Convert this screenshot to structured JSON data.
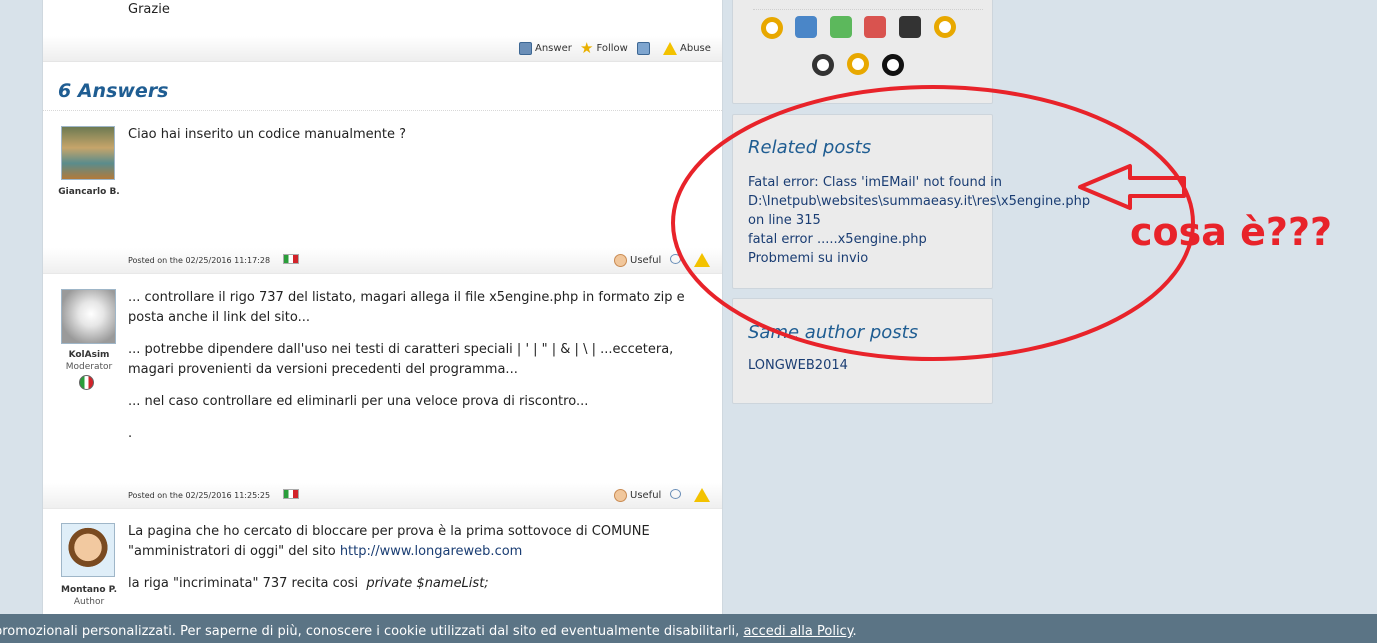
{
  "question": {
    "text": "Grazie",
    "actions": {
      "answer": "Answer",
      "follow": "Follow",
      "abuse": "Abuse"
    }
  },
  "answers_title": "6 Answers",
  "answers": [
    {
      "author": "Giancarlo B.",
      "role": "",
      "paragraphs": [
        "Ciao hai inserito un codice manualmente ?"
      ],
      "posted": "Posted on the 02/25/2016 11:17:28",
      "useful": "Useful"
    },
    {
      "author": "KolAsim",
      "role": "Moderator",
      "paragraphs": [
        "... controllare il rigo 737 del listato, magari allega il file x5engine.php in formato zip e posta anche il link del sito...",
        "... potrebbe dipendere dall'uso nei testi di caratteri speciali | ' | \" | & | \\ | ...eccetera, magari provenienti da versioni precedenti del programma...",
        "... nel caso controllare ed eliminarli per una veloce prova di riscontro...",
        "."
      ],
      "posted": "Posted on the 02/25/2016 11:25:25",
      "useful": "Useful"
    },
    {
      "author": "Montano P.",
      "role": "Author",
      "paragraphs": [
        "La pagina che ho cercato di bloccare per prova è la prima sottovoce di COMUNE \"amministratori di oggi\" del sito",
        "la riga \"incriminata\" 737 recita cosi"
      ],
      "link": "http://www.longareweb.com",
      "code": "private $nameList;"
    }
  ],
  "sidebar": {
    "related_title": "Related posts",
    "related_links": [
      "Fatal error: Class 'imEMail' not found in",
      "D:\\Inetpub\\websites\\summaeasy.it\\res\\x5engine.php",
      "on line 315",
      "fatal error .....x5engine.php",
      "Probmemi su invio"
    ],
    "same_author_title": "Same author posts",
    "same_author_links": [
      "LONGWEB2014"
    ]
  },
  "annotation": {
    "text": "cosa è???",
    "color": "#e8232a"
  },
  "cookie_bar": {
    "text": "promozionali personalizzati. Per saperne di più, conoscere i cookie utilizzati dal sito ed eventualmente disabilitarli,",
    "link": "accedi alla Policy",
    "tail": "."
  },
  "icons": [
    "answer-icon",
    "star-icon",
    "share-icon",
    "warning-icon",
    "hand-icon",
    "flag-italy-icon"
  ]
}
